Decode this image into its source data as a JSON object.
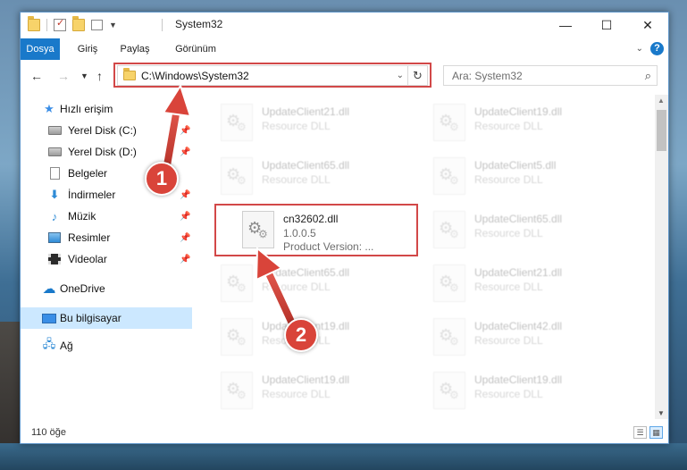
{
  "window": {
    "title": "System32",
    "minimize": "—",
    "maximize": "☐",
    "close": "✕"
  },
  "ribbon": {
    "tabs": [
      "Dosya",
      "Giriş",
      "Paylaş",
      "Görünüm"
    ]
  },
  "address": {
    "path": "C:\\Windows\\System32",
    "refresh": "↻"
  },
  "search": {
    "placeholder": "Ara: System32"
  },
  "sidebar": {
    "items": [
      {
        "label": "Hızlı erişim"
      },
      {
        "label": "Yerel Disk (C:)"
      },
      {
        "label": "Yerel Disk (D:)"
      },
      {
        "label": "Belgeler"
      },
      {
        "label": "İndirmeler"
      },
      {
        "label": "Müzik"
      },
      {
        "label": "Resimler"
      },
      {
        "label": "Videolar"
      },
      {
        "label": "OneDrive"
      },
      {
        "label": "Bu bilgisayar"
      },
      {
        "label": "Ağ"
      }
    ]
  },
  "files": {
    "highlighted": {
      "name": "cn32602.dll",
      "version": "1.0.0.5",
      "product": "Product Version:      ..."
    },
    "faded": [
      {
        "name": "UpdateClient21.dll",
        "desc": "Resource DLL"
      },
      {
        "name": "UpdateClient19.dll",
        "desc": "Resource DLL"
      },
      {
        "name": "UpdateClient65.dll",
        "desc": "Resource DLL"
      },
      {
        "name": "UpdateClient5.dll",
        "desc": "Resource DLL"
      },
      {
        "name": "UpdateClient65.dll",
        "desc": "Resource DLL"
      },
      {
        "name": "UpdateClient65.dll",
        "desc": "Resource DLL"
      },
      {
        "name": "UpdateClient21.dll",
        "desc": "Resource DLL"
      },
      {
        "name": "UpdateClient19.dll",
        "desc": "Resource DLL"
      },
      {
        "name": "UpdateClient42.dll",
        "desc": "Resource DLL"
      },
      {
        "name": "UpdateClient19.dll",
        "desc": "Resource DLL"
      },
      {
        "name": "UpdateClient19.dll",
        "desc": "Resource DLL"
      }
    ]
  },
  "status": {
    "item_count": "110 öğe"
  },
  "callouts": [
    "1",
    "2"
  ],
  "colors": {
    "accent": "#1979ca",
    "highlight": "#d24848",
    "callout": "#d9443a"
  }
}
